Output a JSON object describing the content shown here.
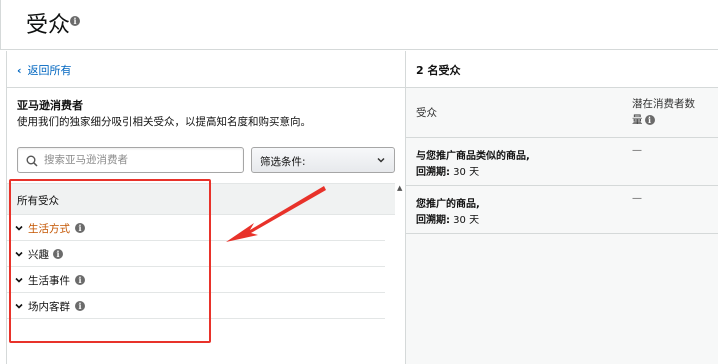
{
  "page": {
    "title": "受众"
  },
  "left": {
    "back_label": "返回所有",
    "section_title": "亚马逊消费者",
    "section_desc": "使用我们的独家细分吸引相关受众，以提高知名度和购买意向。",
    "search_placeholder": "搜索亚马逊消费者",
    "filter_label": "筛选条件:",
    "tree_header": "所有受众",
    "tree_items": [
      {
        "label": "生活方式",
        "highlight": true
      },
      {
        "label": "兴趣",
        "highlight": false
      },
      {
        "label": "生活事件",
        "highlight": false
      },
      {
        "label": "场内客群",
        "highlight": false
      }
    ]
  },
  "right": {
    "header": "2 名受众",
    "col_audience": "受众",
    "col_potential_line1": "潜在消费者数",
    "col_potential_line2": "量",
    "rows": [
      {
        "name": "与您推广商品类似的商品,",
        "lookback_label": "回溯期:",
        "lookback_value": " 30 天",
        "potential": "—"
      },
      {
        "name": "您推广的商品,",
        "lookback_label": "回溯期:",
        "lookback_value": " 30 天",
        "potential": "—"
      }
    ]
  },
  "colors": {
    "link": "#0066c0",
    "highlight": "#c45500",
    "annotation": "#e8322a"
  },
  "icons": [
    "info-icon",
    "chevron-left-icon",
    "search-icon",
    "chevron-down-icon",
    "annotation-arrow"
  ]
}
